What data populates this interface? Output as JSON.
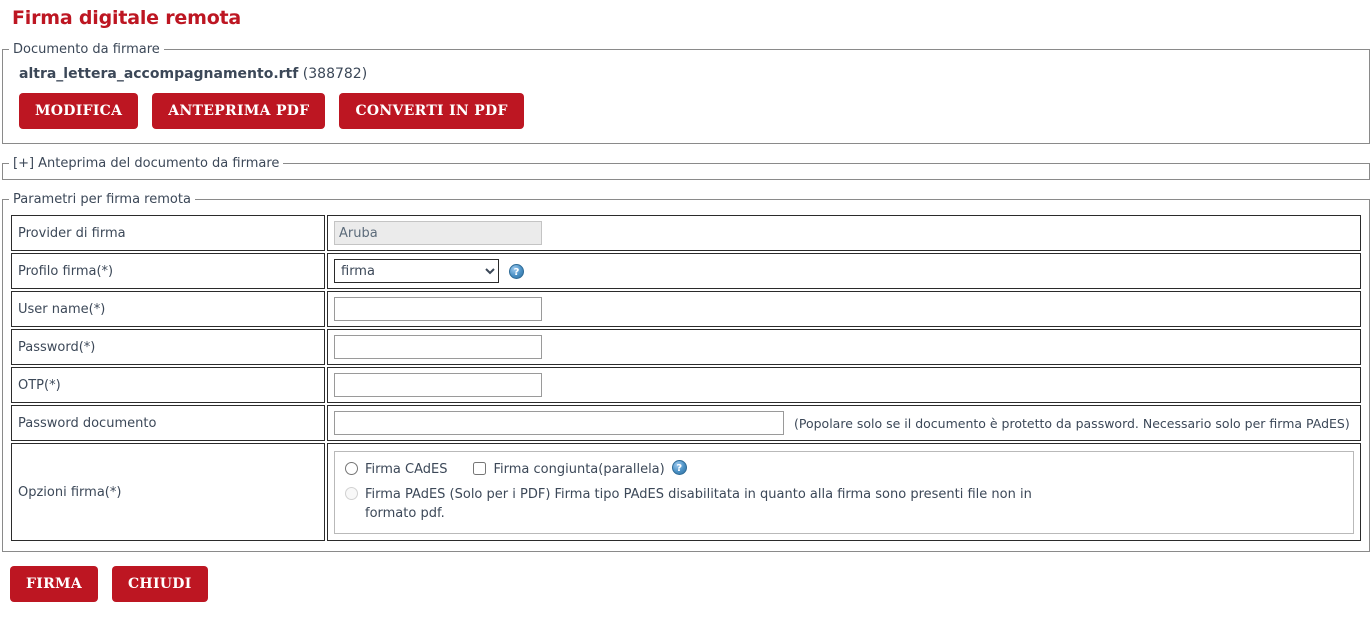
{
  "page": {
    "title": "Firma digitale remota",
    "accent_color": "#bd1622",
    "text_color": "#3c4858"
  },
  "document_panel": {
    "legend": "Documento da firmare",
    "file_name": "altra_lettera_accompagnamento.rtf",
    "file_size": "(388782)",
    "buttons": [
      {
        "label": "MODIFICA",
        "name": "modifica-button"
      },
      {
        "label": "ANTEPRIMA PDF",
        "name": "anteprima-pdf-button"
      },
      {
        "label": "CONVERTI IN PDF",
        "name": "converti-in-pdf-button"
      }
    ]
  },
  "preview_panel": {
    "legend": "[+] Anteprima del documento da firmare"
  },
  "params_panel": {
    "legend": "Parametri per firma remota",
    "rows": {
      "provider": {
        "label": "Provider di firma",
        "value": "Aruba"
      },
      "profilo": {
        "label": "Profilo firma(*)",
        "value": "firma",
        "options": [
          "firma"
        ],
        "help": "?"
      },
      "username": {
        "label": "User name(*)",
        "value": "",
        "placeholder": ""
      },
      "password": {
        "label": "Password(*)",
        "value": "",
        "placeholder": ""
      },
      "otp": {
        "label": "OTP(*)",
        "value": "",
        "placeholder": ""
      },
      "password_documento": {
        "label": "Password documento",
        "value": "",
        "placeholder": "",
        "hint": "(Popolare solo se il documento è protetto da password. Necessario solo per firma PAdES)"
      },
      "opzioni": {
        "label": "Opzioni firma(*)",
        "cades_label": "Firma CAdES",
        "congiunta_label": "Firma congiunta(parallela)",
        "congiunta_help": "?",
        "pades_label": "Firma PAdES (Solo per i PDF) Firma tipo PAdES disabilitata in quanto alla firma sono presenti file non in formato pdf."
      }
    }
  },
  "actions": {
    "buttons": [
      {
        "label": "FIRMA",
        "name": "firma-button"
      },
      {
        "label": "CHIUDI",
        "name": "chiudi-button"
      }
    ]
  }
}
